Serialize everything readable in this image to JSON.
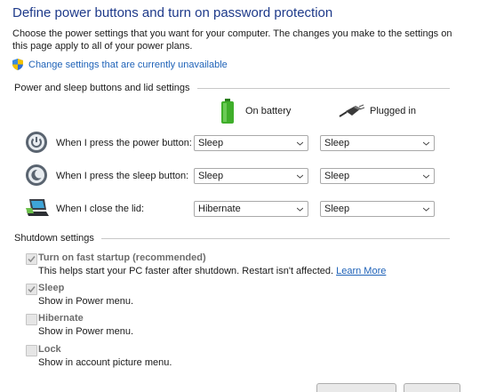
{
  "title": "Define power buttons and turn on password protection",
  "description": "Choose the power settings that you want for your computer. The changes you make to the settings on this page apply to all of your power plans.",
  "change_link": "Change settings that are currently unavailable",
  "sections": {
    "power_sleep": "Power and sleep buttons and lid settings",
    "shutdown": "Shutdown settings"
  },
  "columns": {
    "battery": "On battery",
    "plugged": "Plugged in"
  },
  "rows": [
    {
      "label": "When I press the power button:",
      "battery": "Sleep",
      "plugged": "Sleep",
      "icon": "power-button-icon"
    },
    {
      "label": "When I press the sleep button:",
      "battery": "Sleep",
      "plugged": "Sleep",
      "icon": "sleep-button-icon"
    },
    {
      "label": "When I close the lid:",
      "battery": "Hibernate",
      "plugged": "Sleep",
      "icon": "laptop-lid-icon"
    }
  ],
  "shutdown_options": [
    {
      "title": "Turn on fast startup (recommended)",
      "desc": "This helps start your PC faster after shutdown. Restart isn't affected.",
      "link": "Learn More",
      "checked": true
    },
    {
      "title": "Sleep",
      "desc": "Show in Power menu.",
      "checked": true
    },
    {
      "title": "Hibernate",
      "desc": "Show in Power menu.",
      "checked": false
    },
    {
      "title": "Lock",
      "desc": "Show in account picture menu.",
      "checked": false
    }
  ],
  "colors": {
    "title": "#1e3a8a",
    "link": "#1e62b8",
    "battery_green": "#3fae2a"
  }
}
